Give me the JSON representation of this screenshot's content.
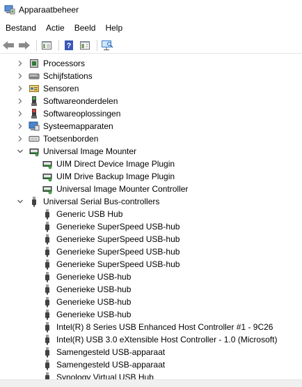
{
  "window": {
    "title": "Apparaatbeheer"
  },
  "menu": [
    "Bestand",
    "Actie",
    "Beeld",
    "Help"
  ],
  "toolbar": [
    "back-icon",
    "forward-icon",
    "show-hide-console-tree-icon",
    "help-icon",
    "properties-icon",
    "scan-hardware-icon"
  ],
  "tree": [
    {
      "label": "Processors",
      "level": 1,
      "state": "collapsed",
      "icon": "processor-icon"
    },
    {
      "label": "Schijfstations",
      "level": 1,
      "state": "collapsed",
      "icon": "disk-drive-icon"
    },
    {
      "label": "Sensoren",
      "level": 1,
      "state": "collapsed",
      "icon": "sensor-icon"
    },
    {
      "label": "Softwareonderdelen",
      "level": 1,
      "state": "collapsed",
      "icon": "software-component-icon"
    },
    {
      "label": "Softwareoplossingen",
      "level": 1,
      "state": "collapsed",
      "icon": "software-device-icon"
    },
    {
      "label": "Systeemapparaten",
      "level": 1,
      "state": "collapsed",
      "icon": "system-device-icon"
    },
    {
      "label": "Toetsenborden",
      "level": 1,
      "state": "collapsed",
      "icon": "keyboard-icon"
    },
    {
      "label": "Universal Image Mounter",
      "level": 1,
      "state": "expanded",
      "icon": "image-mounter-icon"
    },
    {
      "label": "UIM Direct Device Image Plugin",
      "level": 2,
      "icon": "image-mounter-icon"
    },
    {
      "label": "UIM Drive Backup Image Plugin",
      "level": 2,
      "icon": "image-mounter-icon"
    },
    {
      "label": "Universal Image Mounter Controller",
      "level": 2,
      "icon": "image-mounter-icon"
    },
    {
      "label": "Universal Serial Bus-controllers",
      "level": 1,
      "state": "expanded",
      "icon": "usb-icon"
    },
    {
      "label": "Generic USB Hub",
      "level": 2,
      "icon": "usb-icon"
    },
    {
      "label": "Generieke SuperSpeed USB-hub",
      "level": 2,
      "icon": "usb-icon"
    },
    {
      "label": "Generieke SuperSpeed USB-hub",
      "level": 2,
      "icon": "usb-icon"
    },
    {
      "label": "Generieke SuperSpeed USB-hub",
      "level": 2,
      "icon": "usb-icon"
    },
    {
      "label": "Generieke SuperSpeed USB-hub",
      "level": 2,
      "icon": "usb-icon"
    },
    {
      "label": "Generieke USB-hub",
      "level": 2,
      "icon": "usb-icon"
    },
    {
      "label": "Generieke USB-hub",
      "level": 2,
      "icon": "usb-icon"
    },
    {
      "label": "Generieke USB-hub",
      "level": 2,
      "icon": "usb-icon"
    },
    {
      "label": "Generieke USB-hub",
      "level": 2,
      "icon": "usb-icon"
    },
    {
      "label": "Intel(R) 8 Series USB Enhanced Host Controller #1 - 9C26",
      "level": 2,
      "icon": "usb-icon"
    },
    {
      "label": "Intel(R) USB 3.0 eXtensible Host Controller - 1.0 (Microsoft)",
      "level": 2,
      "icon": "usb-icon"
    },
    {
      "label": "Samengesteld USB-apparaat",
      "level": 2,
      "icon": "usb-icon"
    },
    {
      "label": "Samengesteld USB-apparaat",
      "level": 2,
      "icon": "usb-icon"
    },
    {
      "label": "Synology Virtual USB Hub",
      "level": 2,
      "icon": "usb-icon"
    }
  ]
}
